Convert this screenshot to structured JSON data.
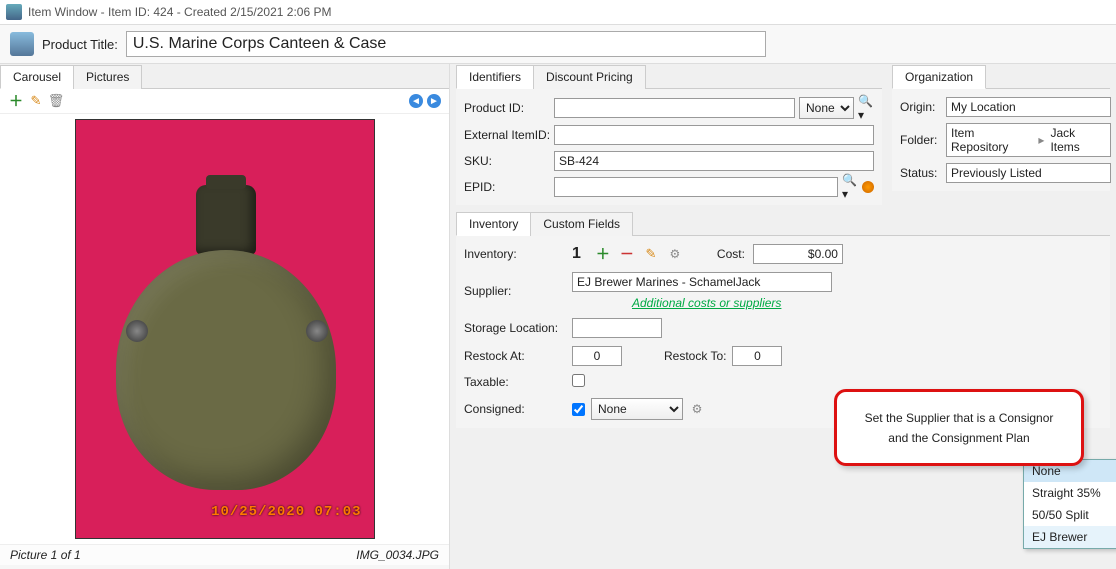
{
  "window": {
    "title": "Item Window - Item ID: 424 - Created 2/15/2021 2:06 PM"
  },
  "product": {
    "title_label": "Product Title:",
    "title_value": "U.S. Marine Corps Canteen & Case"
  },
  "left_tabs": {
    "carousel": "Carousel",
    "pictures": "Pictures"
  },
  "picture": {
    "counter": "Picture 1 of 1",
    "filename": "IMG_0034.JPG",
    "stamp": "10/25/2020 07:03"
  },
  "ident_tabs": {
    "identifiers": "Identifiers",
    "discount": "Discount Pricing"
  },
  "identifiers": {
    "product_id_label": "Product ID:",
    "product_id_value": "",
    "product_id_type": "None",
    "ext_label": "External ItemID:",
    "ext_value": "",
    "sku_label": "SKU:",
    "sku_value": "SB-424",
    "epid_label": "EPID:",
    "epid_value": ""
  },
  "org_tab": "Organization",
  "organization": {
    "origin_label": "Origin:",
    "origin_value": "My Location",
    "folder_label": "Folder:",
    "folder_root": "Item Repository",
    "folder_leaf": "Jack Items",
    "status_label": "Status:",
    "status_value": "Previously Listed"
  },
  "inv_tabs": {
    "inventory": "Inventory",
    "custom": "Custom Fields"
  },
  "inventory": {
    "inventory_label": "Inventory:",
    "qty": "1",
    "cost_label": "Cost:",
    "cost_value": "$0.00",
    "supplier_label": "Supplier:",
    "supplier_value": "EJ Brewer Marines - SchamelJack",
    "addl_link": "Additional costs or suppliers",
    "storage_label": "Storage Location:",
    "storage_value": "",
    "restock_at_label": "Restock At:",
    "restock_at_value": "0",
    "restock_to_label": "Restock To:",
    "restock_to_value": "0",
    "taxable_label": "Taxable:",
    "taxable_checked": false,
    "consigned_label": "Consigned:",
    "consigned_checked": true,
    "consigned_plan": "None",
    "plan_options": [
      "None",
      "Straight 35%",
      "50/50 Split",
      "EJ Brewer"
    ]
  },
  "callout": {
    "text": "Set the Supplier that is a Consignor and the Consignment Plan"
  }
}
